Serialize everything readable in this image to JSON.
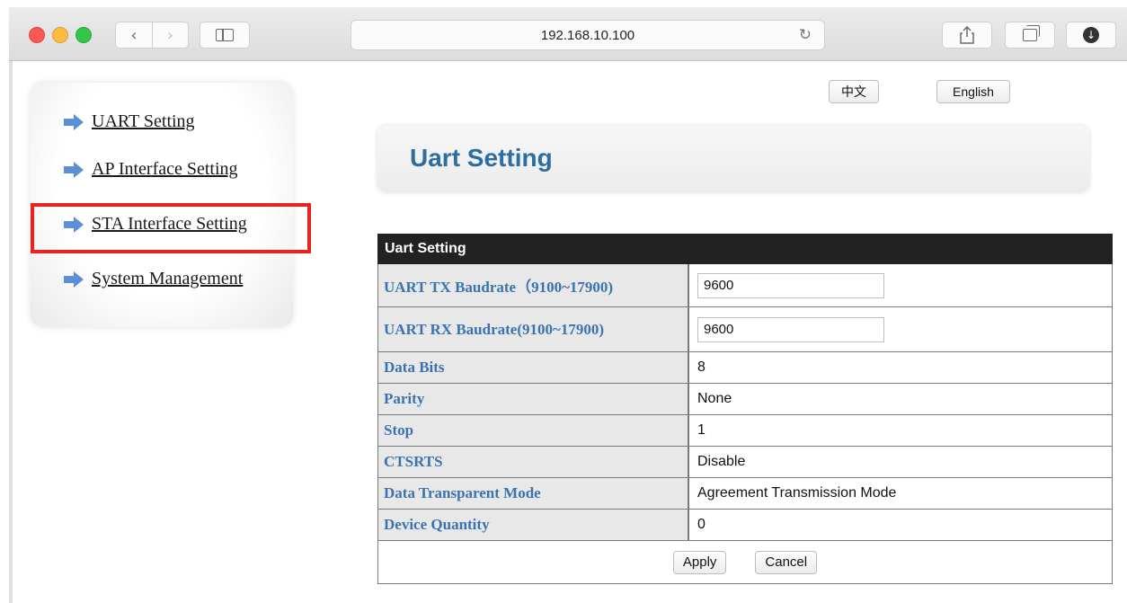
{
  "browser": {
    "url": "192.168.10.100"
  },
  "sidebar": {
    "items": [
      {
        "label": "UART Setting"
      },
      {
        "label": "AP Interface Setting"
      },
      {
        "label": "STA Interface Setting"
      },
      {
        "label": "System Management"
      }
    ]
  },
  "language": {
    "chinese_label": "中文",
    "english_label": "English"
  },
  "header": {
    "title": "Uart Setting"
  },
  "table": {
    "heading": "Uart Setting",
    "rows": [
      {
        "label": "UART TX Baudrate（9100~17900)",
        "value": "9600"
      },
      {
        "label": "UART RX Baudrate(9100~17900)",
        "value": "9600"
      },
      {
        "label": "Data Bits",
        "value": "8"
      },
      {
        "label": "Parity",
        "value": "None"
      },
      {
        "label": "Stop",
        "value": "1"
      },
      {
        "label": "CTSRTS",
        "value": "Disable"
      },
      {
        "label": "Data Transparent Mode",
        "value": "Agreement Transmission Mode"
      },
      {
        "label": "Device Quantity",
        "value": "0"
      }
    ],
    "apply_label": "Apply",
    "cancel_label": "Cancel"
  },
  "icons": {
    "nav_arrow": "arrow-right-icon",
    "back": "chevron-left-icon",
    "forward": "chevron-right-icon",
    "reload": "reload-icon",
    "share": "share-icon",
    "tabs": "tabs-icon",
    "download": "download-icon"
  },
  "colors": {
    "highlight": "#e8231e",
    "label_blue": "#3a73b0",
    "title_blue": "#2b6ea3"
  }
}
